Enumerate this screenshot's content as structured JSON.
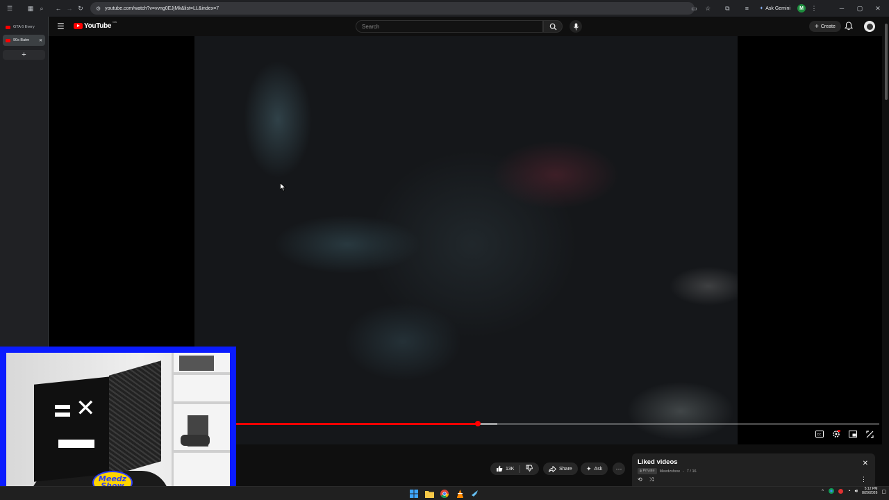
{
  "browser": {
    "url": "youtube.com/watch?v=vvng0EJjMk&list=LL&index=7",
    "ask_gemini_label": "Ask Gemini",
    "profile_initial": "M"
  },
  "tabs": [
    {
      "label": "GTA 6 Every",
      "active": false
    },
    {
      "label": "90s Batm",
      "active": true
    }
  ],
  "new_tab_label": "+",
  "youtube": {
    "logo_text": "YouTube",
    "country_code": "MA",
    "search_placeholder": "Search",
    "create_label": "Create"
  },
  "player": {
    "progress_fraction": 0.517,
    "buffer_fraction": 0.54
  },
  "actions": {
    "like_count": "13K",
    "share_label": "Share",
    "ask_label": "Ask"
  },
  "playlist": {
    "title": "Liked videos",
    "privacy": "Private",
    "owner": "Meedzshow",
    "position": "7 / 16"
  },
  "webcam": {
    "badge_line1": "Meedz",
    "badge_line2": "Show"
  },
  "taskbar": {
    "time": "5:12 PM",
    "date": "8/29/2026"
  },
  "colors": {
    "accent_red": "#ff0000",
    "webcam_border": "#0a1bff",
    "background": "#0f0f0f"
  }
}
